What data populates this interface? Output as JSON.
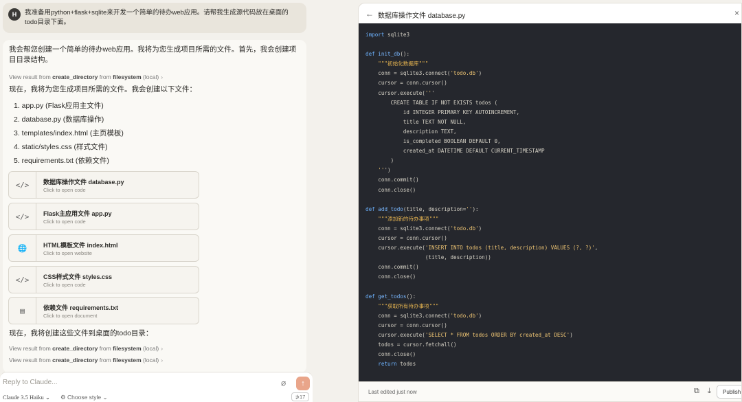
{
  "user_message": {
    "avatar": "H",
    "text": "我准备用python+flask+sqlite来开发一个简单的待办web应用。请帮我生成源代码放在桌面的todo目录下面。"
  },
  "assistant": {
    "intro": "我会帮您创建一个简单的待办web应用。我将为您生成项目所需的文件。首先，我会创建项目目录结构。",
    "tool_result_1": {
      "prefix": "View result from",
      "tool": "create_directory",
      "mid": "from",
      "server": "filesystem",
      "suffix": "(local)"
    },
    "files_intro": "现在，我将为您生成项目所需的文件。我会创建以下文件：",
    "file_list": [
      "1. app.py (Flask应用主文件)",
      "2. database.py (数据库操作)",
      "3. templates/index.html (主页模板)",
      "4. static/styles.css (样式文件)",
      "5. requirements.txt (依赖文件)"
    ],
    "cards": [
      {
        "icon": "code-icon",
        "glyph": "</>",
        "title": "数据库操作文件 database.py",
        "subtitle": "Click to open code"
      },
      {
        "icon": "code-icon",
        "glyph": "</>",
        "title": "Flask主应用文件 app.py",
        "subtitle": "Click to open code"
      },
      {
        "icon": "globe-icon",
        "glyph": "🌐",
        "title": "HTML模板文件 index.html",
        "subtitle": "Click to open website"
      },
      {
        "icon": "code-icon",
        "glyph": "</>",
        "title": "CSS样式文件 styles.css",
        "subtitle": "Click to open code"
      },
      {
        "icon": "document-icon",
        "glyph": "▤",
        "title": "依赖文件 requirements.txt",
        "subtitle": "Click to open document"
      }
    ],
    "outro": "现在，我将创建这些文件到桌面的todo目录：",
    "tool_result_2": {
      "prefix": "View result from",
      "tool": "create_directory",
      "mid": "from",
      "server": "filesystem",
      "suffix": "(local)"
    },
    "tool_result_3": {
      "prefix": "View result from",
      "tool": "create_directory",
      "mid": "from",
      "server": "filesystem",
      "suffix": "(local)"
    }
  },
  "composer": {
    "placeholder": "Reply to Claude...",
    "model": "Claude 3.5 Haiku",
    "style": "Choose style",
    "count": "⊅17"
  },
  "artifact": {
    "title": "数据库操作文件 database.py",
    "footer_text": "Last edited just now",
    "publish_label": "Publish",
    "code_lines": [
      "import sqlite3",
      "",
      "def init_db():",
      "    \"\"\"初始化数据库\"\"\"",
      "    conn = sqlite3.connect('todo.db')",
      "    cursor = conn.cursor()",
      "    cursor.execute('''",
      "        CREATE TABLE IF NOT EXISTS todos (",
      "            id INTEGER PRIMARY KEY AUTOINCREMENT,",
      "            title TEXT NOT NULL,",
      "            description TEXT,",
      "            is_completed BOOLEAN DEFAULT 0,",
      "            created_at DATETIME DEFAULT CURRENT_TIMESTAMP",
      "        )",
      "    ''')",
      "    conn.commit()",
      "    conn.close()",
      "",
      "def add_todo(title, description=''):",
      "    \"\"\"添加新的待办事项\"\"\"",
      "    conn = sqlite3.connect('todo.db')",
      "    cursor = conn.cursor()",
      "    cursor.execute('INSERT INTO todos (title, description) VALUES (?, ?)',",
      "                   (title, description))",
      "    conn.commit()",
      "    conn.close()",
      "",
      "def get_todos():",
      "    \"\"\"获取所有待办事项\"\"\"",
      "    conn = sqlite3.connect('todo.db')",
      "    cursor = conn.cursor()",
      "    cursor.execute('SELECT * FROM todos ORDER BY created_at DESC')",
      "    todos = cursor.fetchall()",
      "    conn.close()",
      "    return todos"
    ]
  }
}
